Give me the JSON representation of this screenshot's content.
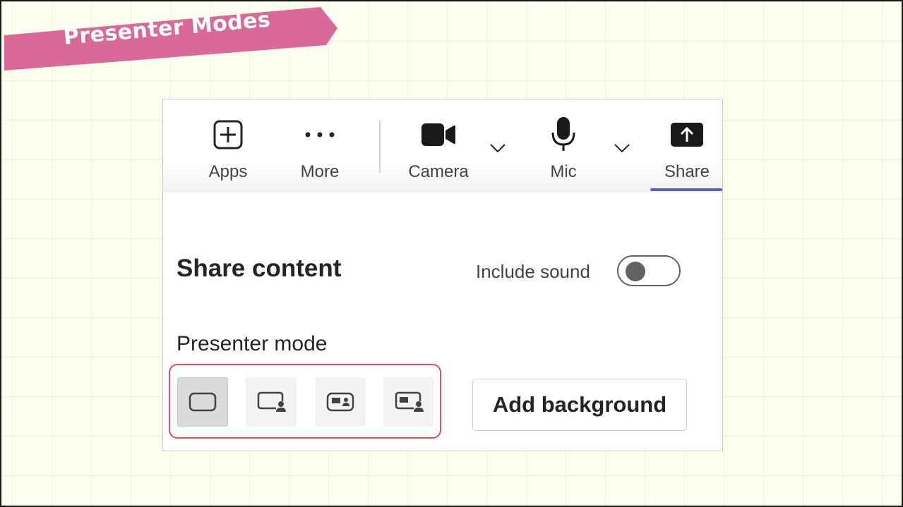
{
  "banner": {
    "title": "Presenter Modes"
  },
  "toolbar": {
    "apps_label": "Apps",
    "more_label": "More",
    "camera_label": "Camera",
    "mic_label": "Mic",
    "share_label": "Share"
  },
  "share_panel": {
    "title": "Share content",
    "include_sound_label": "Include sound",
    "include_sound_on": false,
    "presenter_mode_label": "Presenter mode",
    "modes": [
      {
        "icon": "content-only-icon",
        "selected": true
      },
      {
        "icon": "standout-icon",
        "selected": false
      },
      {
        "icon": "side-by-side-icon",
        "selected": false
      },
      {
        "icon": "reporter-icon",
        "selected": false
      }
    ],
    "add_background_label": "Add background"
  },
  "colors": {
    "banner": "#d96a97",
    "accent": "#5b5fc7",
    "highlight": "#e0505a"
  }
}
